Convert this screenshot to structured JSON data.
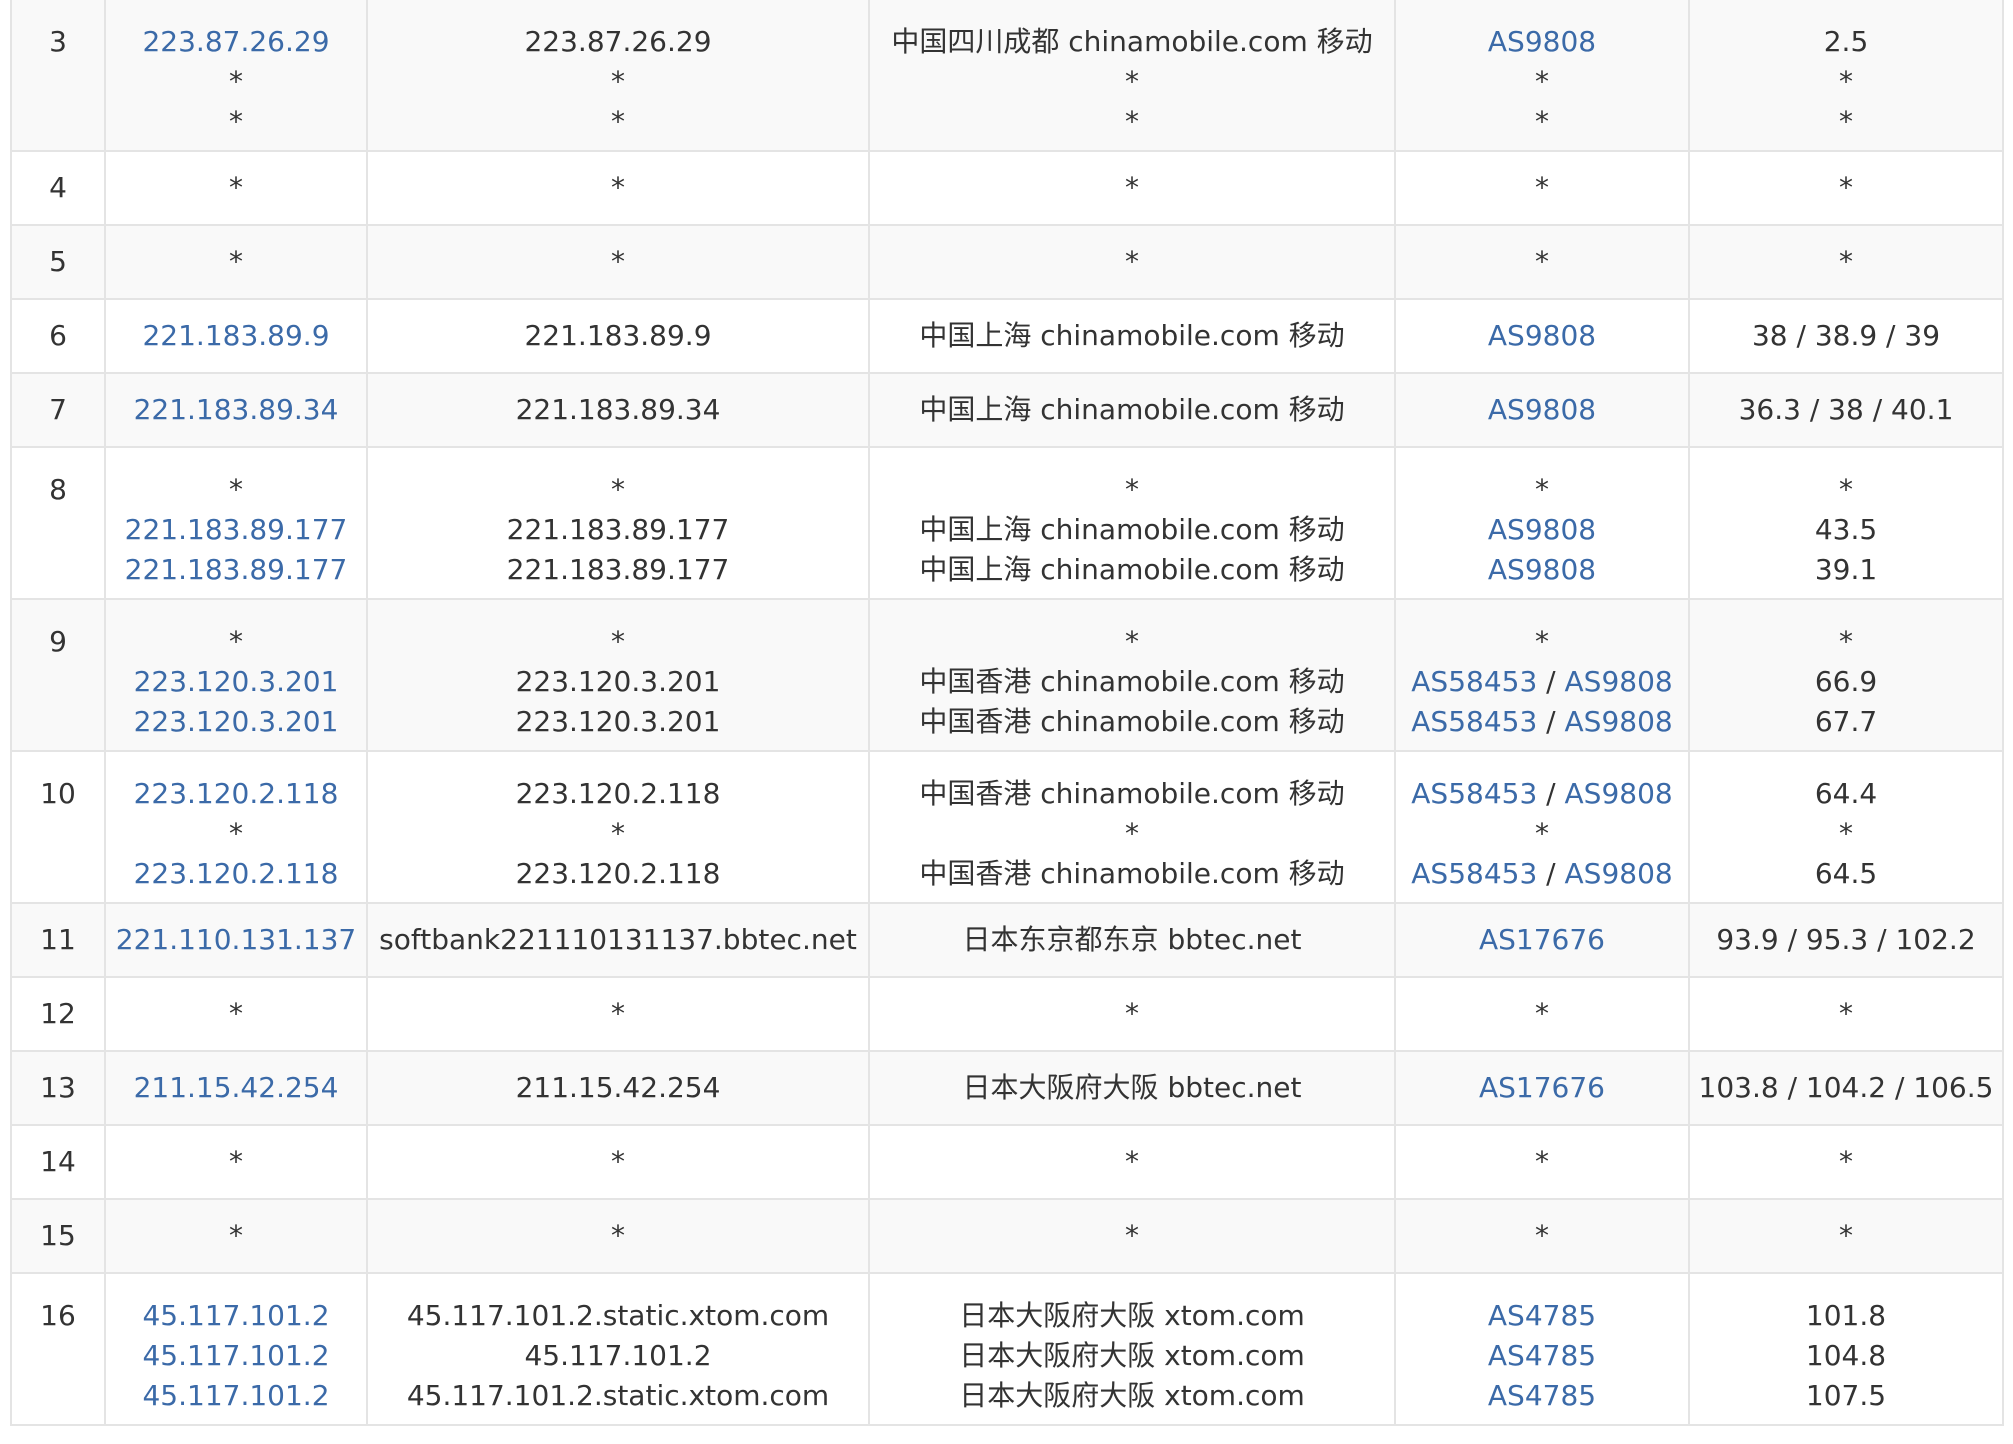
{
  "colors": {
    "link": "#3b6aa8",
    "text": "#333333",
    "stripe": "#f9f9f9",
    "border": "#e4e4e4"
  },
  "rows": [
    {
      "hop": "3",
      "ip": [
        "223.87.26.29",
        "*",
        "*"
      ],
      "host": [
        "223.87.26.29",
        "*",
        "*"
      ],
      "location": [
        "中国四川成都 chinamobile.com 移动",
        "*",
        "*"
      ],
      "asn": [
        [
          "AS9808"
        ],
        [
          "*"
        ],
        [
          "*"
        ]
      ],
      "time": [
        "2.5",
        "*",
        "*"
      ]
    },
    {
      "hop": "4",
      "ip": [
        "*"
      ],
      "host": [
        "*"
      ],
      "location": [
        "*"
      ],
      "asn": [
        [
          "*"
        ]
      ],
      "time": [
        "*"
      ]
    },
    {
      "hop": "5",
      "ip": [
        "*"
      ],
      "host": [
        "*"
      ],
      "location": [
        "*"
      ],
      "asn": [
        [
          "*"
        ]
      ],
      "time": [
        "*"
      ]
    },
    {
      "hop": "6",
      "ip": [
        "221.183.89.9"
      ],
      "host": [
        "221.183.89.9"
      ],
      "location": [
        "中国上海 chinamobile.com 移动"
      ],
      "asn": [
        [
          "AS9808"
        ]
      ],
      "time": [
        "38 / 38.9 / 39"
      ]
    },
    {
      "hop": "7",
      "ip": [
        "221.183.89.34"
      ],
      "host": [
        "221.183.89.34"
      ],
      "location": [
        "中国上海 chinamobile.com 移动"
      ],
      "asn": [
        [
          "AS9808"
        ]
      ],
      "time": [
        "36.3 / 38 / 40.1"
      ]
    },
    {
      "hop": "8",
      "ip": [
        "*",
        "221.183.89.177",
        "221.183.89.177"
      ],
      "host": [
        "*",
        "221.183.89.177",
        "221.183.89.177"
      ],
      "location": [
        "*",
        "中国上海 chinamobile.com 移动",
        "中国上海 chinamobile.com 移动"
      ],
      "asn": [
        [
          "*"
        ],
        [
          "AS9808"
        ],
        [
          "AS9808"
        ]
      ],
      "time": [
        "*",
        "43.5",
        "39.1"
      ]
    },
    {
      "hop": "9",
      "ip": [
        "*",
        "223.120.3.201",
        "223.120.3.201"
      ],
      "host": [
        "*",
        "223.120.3.201",
        "223.120.3.201"
      ],
      "location": [
        "*",
        "中国香港 chinamobile.com 移动",
        "中国香港 chinamobile.com 移动"
      ],
      "asn": [
        [
          "*"
        ],
        [
          "AS58453",
          "AS9808"
        ],
        [
          "AS58453",
          "AS9808"
        ]
      ],
      "time": [
        "*",
        "66.9",
        "67.7"
      ]
    },
    {
      "hop": "10",
      "ip": [
        "223.120.2.118",
        "*",
        "223.120.2.118"
      ],
      "host": [
        "223.120.2.118",
        "*",
        "223.120.2.118"
      ],
      "location": [
        "中国香港 chinamobile.com 移动",
        "*",
        "中国香港 chinamobile.com 移动"
      ],
      "asn": [
        [
          "AS58453",
          "AS9808"
        ],
        [
          "*"
        ],
        [
          "AS58453",
          "AS9808"
        ]
      ],
      "time": [
        "64.4",
        "*",
        "64.5"
      ]
    },
    {
      "hop": "11",
      "ip": [
        "221.110.131.137"
      ],
      "host": [
        "softbank221110131137.bbtec.net"
      ],
      "location": [
        "日本东京都东京 bbtec.net"
      ],
      "asn": [
        [
          "AS17676"
        ]
      ],
      "time": [
        "93.9 / 95.3 / 102.2"
      ]
    },
    {
      "hop": "12",
      "ip": [
        "*"
      ],
      "host": [
        "*"
      ],
      "location": [
        "*"
      ],
      "asn": [
        [
          "*"
        ]
      ],
      "time": [
        "*"
      ]
    },
    {
      "hop": "13",
      "ip": [
        "211.15.42.254"
      ],
      "host": [
        "211.15.42.254"
      ],
      "location": [
        "日本大阪府大阪 bbtec.net"
      ],
      "asn": [
        [
          "AS17676"
        ]
      ],
      "time": [
        "103.8 / 104.2 / 106.5"
      ]
    },
    {
      "hop": "14",
      "ip": [
        "*"
      ],
      "host": [
        "*"
      ],
      "location": [
        "*"
      ],
      "asn": [
        [
          "*"
        ]
      ],
      "time": [
        "*"
      ]
    },
    {
      "hop": "15",
      "ip": [
        "*"
      ],
      "host": [
        "*"
      ],
      "location": [
        "*"
      ],
      "asn": [
        [
          "*"
        ]
      ],
      "time": [
        "*"
      ]
    },
    {
      "hop": "16",
      "ip": [
        "45.117.101.2",
        "45.117.101.2",
        "45.117.101.2"
      ],
      "host": [
        "45.117.101.2.static.xtom.com",
        "45.117.101.2",
        "45.117.101.2.static.xtom.com"
      ],
      "location": [
        "日本大阪府大阪 xtom.com",
        "日本大阪府大阪 xtom.com",
        "日本大阪府大阪 xtom.com"
      ],
      "asn": [
        [
          "AS4785"
        ],
        [
          "AS4785"
        ],
        [
          "AS4785"
        ]
      ],
      "time": [
        "101.8",
        "104.8",
        "107.5"
      ]
    }
  ]
}
